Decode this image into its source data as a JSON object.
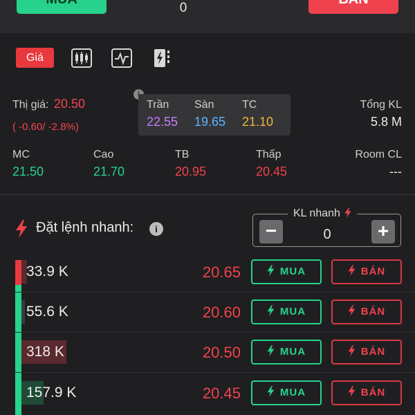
{
  "topbar": {
    "buy_label": "MUA",
    "sell_label": "BÁN",
    "quantity": "0"
  },
  "tabs": [
    {
      "label": "Giá",
      "icon": "price-tab"
    },
    {
      "label": "",
      "icon": "candlestick-chart-icon"
    },
    {
      "label": "",
      "icon": "line-chart-icon"
    },
    {
      "label": "",
      "icon": "lightning-document-icon"
    }
  ],
  "price_info": {
    "market_label": "Thị giá:",
    "market_price": "20.50",
    "change": "( -0.60/ -2.8%)",
    "ceiling_label": "Trần",
    "ceiling_value": "22.55",
    "floor_label": "Sàn",
    "floor_value": "19.65",
    "ref_label": "TC",
    "ref_value": "21.10",
    "total_vol_label": "Tổng KL",
    "total_vol_value": "5.8 M",
    "open_label": "MC",
    "open_value": "21.50",
    "high_label": "Cao",
    "high_value": "21.70",
    "avg_label": "TB",
    "avg_value": "20.95",
    "low_label": "Thấp",
    "low_value": "20.45",
    "room_label": "Room CL",
    "room_value": "---"
  },
  "quick_order": {
    "title": "Đặt lệnh nhanh:",
    "kl_label": "KL nhanh",
    "kl_value": "0",
    "minus": "−",
    "plus": "+"
  },
  "order_book": [
    {
      "volume": "33.9 K",
      "price": "20.65",
      "buy_label": "MUA",
      "sell_label": "BÁN",
      "bar_fraction": 0.03
    },
    {
      "volume": "55.6 K",
      "price": "20.60",
      "buy_label": "MUA",
      "sell_label": "BÁN",
      "bar_fraction": 0.02
    },
    {
      "volume": "318 K",
      "price": "20.50",
      "buy_label": "MUA",
      "sell_label": "BÁN",
      "bar_fraction": 0.24
    },
    {
      "volume": "157.9 K",
      "price": "20.45",
      "buy_label": "MUA",
      "sell_label": "BÁN",
      "bar_fraction": 0.12
    }
  ],
  "colors": {
    "buy": "#27d38c",
    "sell": "#f0424e",
    "ceiling": "#c77dff",
    "floor": "#5bb6ff",
    "reference": "#f0b43c"
  }
}
